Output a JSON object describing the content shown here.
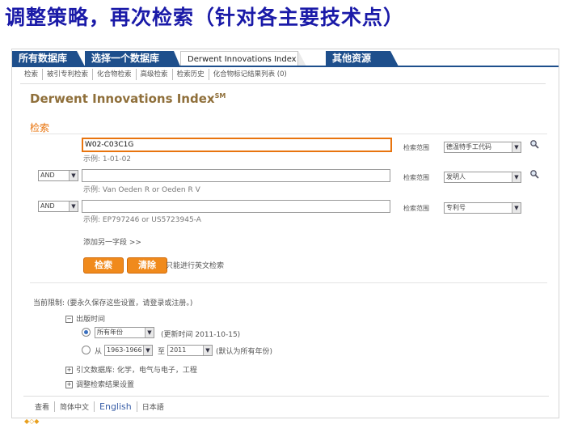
{
  "slide": {
    "title": "调整策略，再次检索（针对各主要技术点）"
  },
  "tabs": [
    "所有数据库",
    "选择一个数据库",
    "Derwent Innovations Index",
    "其他资源"
  ],
  "subnav": [
    "检索",
    "被引专利检索",
    "化合物检索",
    "高级检索",
    "检索历史",
    "化合物标记结果列表 (0)"
  ],
  "product": {
    "title": "Derwent Innovations Index",
    "sup": "SM"
  },
  "search": {
    "label": "检索",
    "rows": [
      {
        "operator": "",
        "value": "W02-C03C1G",
        "hint": "示例: 1-01-02",
        "scope_label": "检索范围",
        "scope": "德温特手工代码"
      },
      {
        "operator": "AND",
        "value": "",
        "hint": "示例: Van Oeden R or Oeden R V",
        "scope_label": "检索范围",
        "scope": "发明人"
      },
      {
        "operator": "AND",
        "value": "",
        "hint": "示例: EP797246 or US5723945-A",
        "scope_label": "检索范围",
        "scope": "专利号"
      }
    ],
    "add_field": "添加另一字段 >>",
    "search_button": "检索",
    "clear_button": "清除",
    "english_note": "只能进行英文检索"
  },
  "limits": {
    "title": "当前限制: (要永久保存这些设置，请登录或注册。)",
    "pub_date_label": "出版时间",
    "all_years": "所有年份",
    "update_note": "(更新时间 2011-10-15)",
    "from_label": "从",
    "from_year": "1963-1966",
    "to_label": "至",
    "to_year": "2011",
    "default_note": "(默认为所有年份)",
    "citation_db": "引文数据库: 化学，电气与电子，工程",
    "adjust_results": "调整检索结果设置"
  },
  "footer": [
    "查看",
    "简体中文",
    "English",
    "日本語"
  ],
  "colors": {
    "tab_blue": "#1e4f8c",
    "accent_orange": "#f08a1c",
    "title_blue": "#1a1aa8"
  }
}
